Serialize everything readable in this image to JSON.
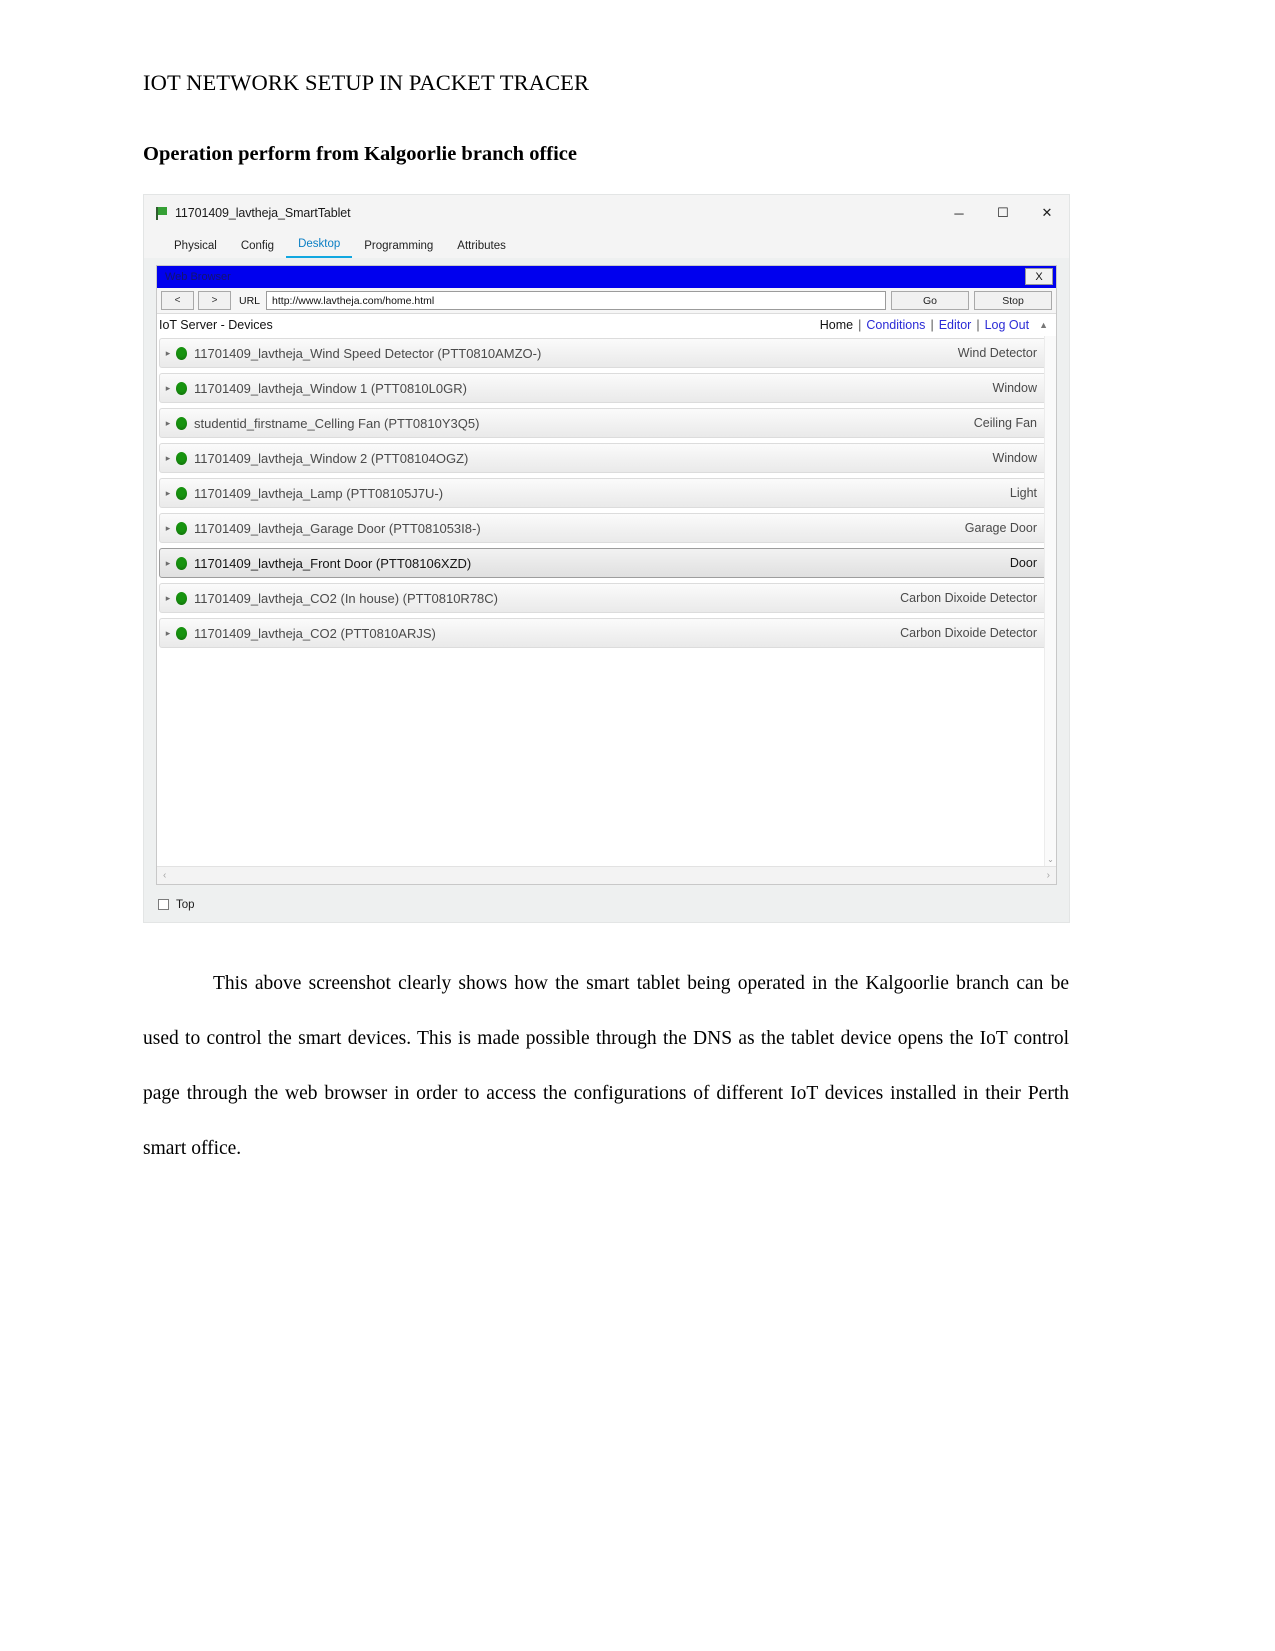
{
  "document": {
    "title": "IOT NETWORK SETUP IN PACKET TRACER",
    "heading": "Operation perform from Kalgoorlie branch office",
    "body": "This above screenshot clearly shows how the smart tablet being operated in the Kalgoorlie branch can be used to control the smart devices. This is made possible through the DNS as the tablet device opens the IoT control page through the web browser in order to access the configurations of different IoT devices installed in their Perth smart office."
  },
  "window": {
    "title": "11701409_lavtheja_SmartTablet",
    "icon": "packet-tracer-flag-icon",
    "minimize": "─",
    "maximize": "☐",
    "close": "✕",
    "tabs": [
      {
        "label": "Physical",
        "active": false
      },
      {
        "label": "Config",
        "active": false
      },
      {
        "label": "Desktop",
        "active": true
      },
      {
        "label": "Programming",
        "active": false
      },
      {
        "label": "Attributes",
        "active": false
      }
    ],
    "bottom": {
      "checkbox_label": "Top",
      "checked": false
    }
  },
  "browser": {
    "title": "Web Browser",
    "close_label": "X",
    "back_label": "<",
    "forward_label": ">",
    "url_label": "URL",
    "url_value": "http://www.lavtheja.com/home.html",
    "go_label": "Go",
    "stop_label": "Stop"
  },
  "iot": {
    "page_title": "IoT Server - Devices",
    "nav": {
      "home": "Home",
      "conditions": "Conditions",
      "editor": "Editor",
      "logout": "Log Out",
      "separator": "|",
      "caret": "▲"
    },
    "devices": [
      {
        "name": "11701409_lavtheja_Wind Speed Detector (PTT0810AMZO-)",
        "type": "Wind Detector",
        "status": "on",
        "selected": false
      },
      {
        "name": "11701409_lavtheja_Window 1 (PTT0810L0GR)",
        "type": "Window",
        "status": "on",
        "selected": false
      },
      {
        "name": "studentid_firstname_Celling Fan (PTT0810Y3Q5)",
        "type": "Ceiling Fan",
        "status": "on",
        "selected": false
      },
      {
        "name": "11701409_lavtheja_Window 2 (PTT08104OGZ)",
        "type": "Window",
        "status": "on",
        "selected": false
      },
      {
        "name": "11701409_lavtheja_Lamp (PTT08105J7U-)",
        "type": "Light",
        "status": "on",
        "selected": false
      },
      {
        "name": "11701409_lavtheja_Garage Door (PTT081053I8-)",
        "type": "Garage Door",
        "status": "on",
        "selected": false
      },
      {
        "name": "11701409_lavtheja_Front Door (PTT08106XZD)",
        "type": "Door",
        "status": "on",
        "selected": true
      },
      {
        "name": "11701409_lavtheja_CO2 (In house) (PTT0810R78C)",
        "type": "Carbon Dixoide Detector",
        "status": "on",
        "selected": false
      },
      {
        "name": "11701409_lavtheja_CO2 (PTT0810ARJS)",
        "type": "Carbon Dixoide Detector",
        "status": "on",
        "selected": false
      }
    ],
    "expand_arrow": "▸",
    "scroll": {
      "left_arrow": "‹",
      "right_arrow": "›",
      "down_arrow": "⌄"
    }
  },
  "colors": {
    "accent_tab": "#11a7e0",
    "link": "#2b2bd6",
    "browser_titlebar": "#0000ee",
    "led_on": "#17930f"
  }
}
